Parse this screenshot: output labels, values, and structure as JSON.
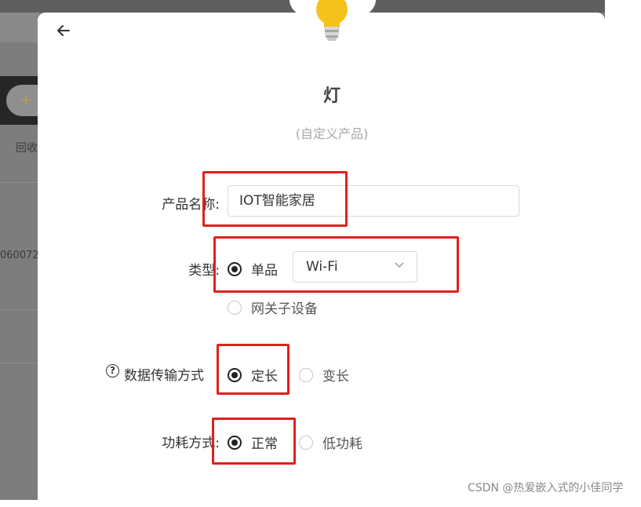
{
  "backdrop": {
    "partial_text_1": "回收",
    "partial_text_2": "060072"
  },
  "modal": {
    "title": "灯",
    "subtitle": "(自定义产品)",
    "product_name": {
      "label": "产品名称:",
      "value": "IOT智能家居"
    },
    "type": {
      "label": "类型:",
      "options": [
        "单品",
        "网关子设备"
      ],
      "selected": "单品",
      "network_select": {
        "value": "Wi-Fi"
      }
    },
    "data_transfer": {
      "label": "数据传输方式",
      "options": [
        "定长",
        "变长"
      ],
      "selected": "定长"
    },
    "power_mode": {
      "label": "功耗方式:",
      "options": [
        "正常",
        "低功耗"
      ],
      "selected": "正常"
    }
  },
  "icons": {
    "back": "arrow-left-icon",
    "product": "light-bulb-icon",
    "help": "question-circle-icon",
    "dropdown": "chevron-down-icon"
  },
  "colors": {
    "highlight_red": "#e0201e",
    "backdrop": "#7d7d7d"
  },
  "watermark": "CSDN @热爱嵌入式的小佳同学"
}
